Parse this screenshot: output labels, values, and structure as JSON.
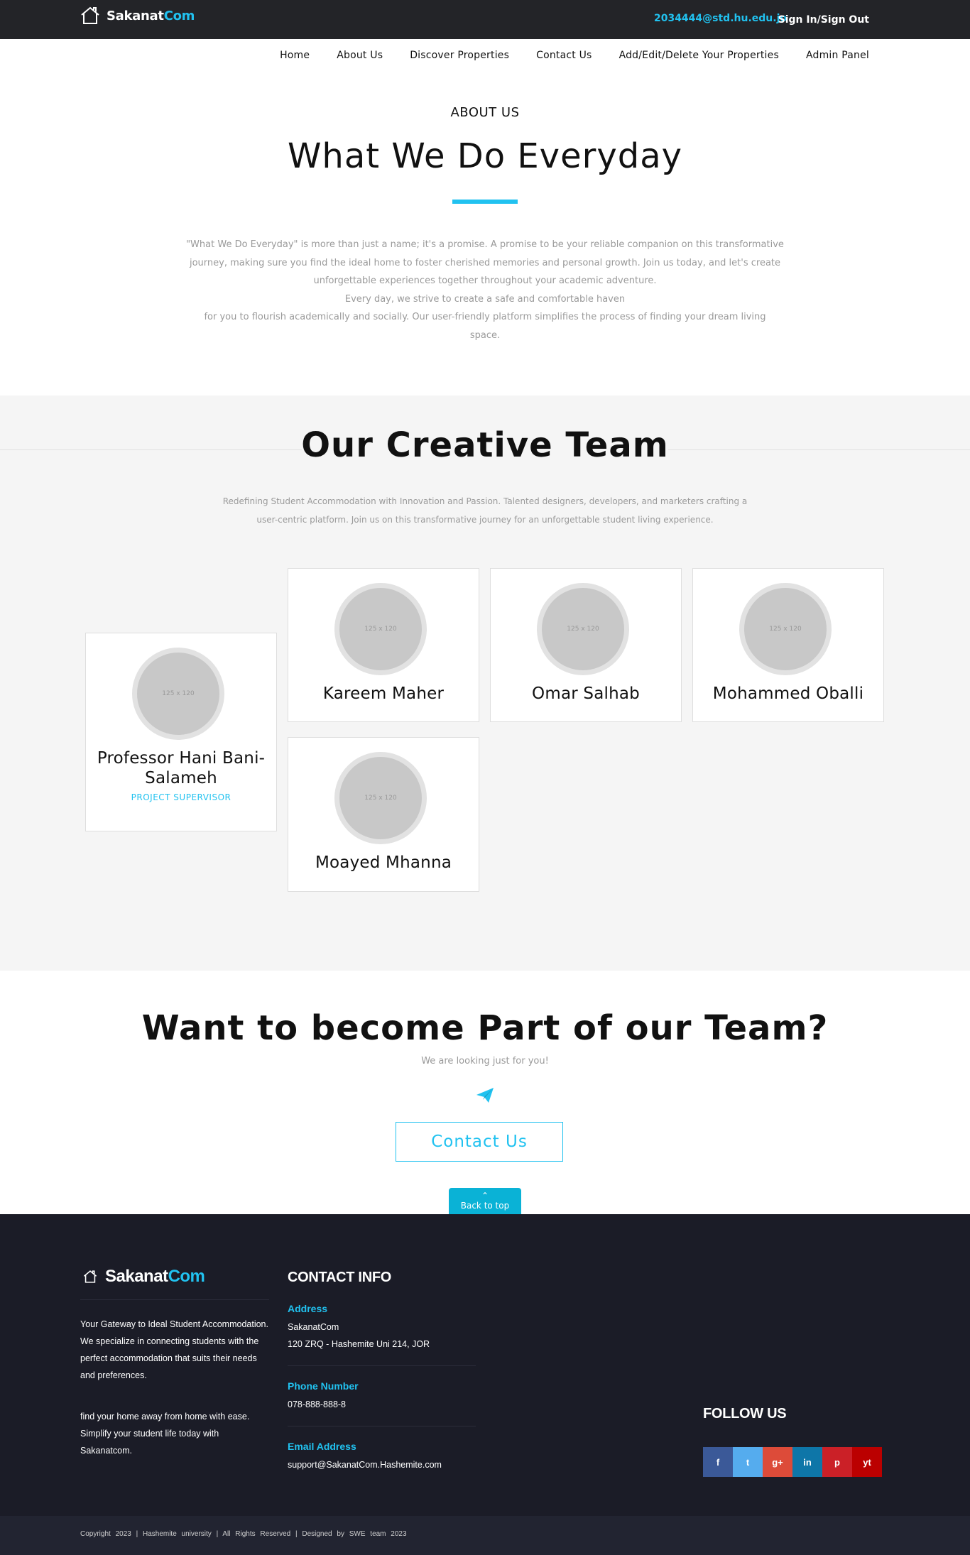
{
  "header": {
    "brand_primary": "Sakanat",
    "brand_accent": "Com",
    "email": "2034444@std.hu.edu.jo",
    "sign_in": "Sign In/Sign Out"
  },
  "nav": [
    "Home",
    "About Us",
    "Discover Properties",
    "Contact Us",
    "Add/Edit/Delete Your Properties",
    "Admin Panel"
  ],
  "about": {
    "kicker": "ABOUT US",
    "title": "What We Do Everyday",
    "line1": "\"What We Do Everyday\" is more than just a name; it's a promise. A promise to be your reliable companion on this transformative",
    "line2": "journey, making sure you find the ideal home to foster cherished memories and personal growth. Join us today, and let's create",
    "line3": "unforgettable experiences together throughout your academic adventure.",
    "line4": "Every day, we strive to create a safe and comfortable haven",
    "line5": "for you to flourish academically and socially. Our user-friendly platform simplifies the process of finding your dream living",
    "line6": "space."
  },
  "team": {
    "title": "Our Creative Team",
    "sub1": "Redefining Student Accommodation with Innovation and Passion. Talented designers, developers, and marketers crafting a",
    "sub2": "user-centric platform. Join us on this transformative journey for an unforgettable student living experience.",
    "placeholder": "125 x 120",
    "members": [
      {
        "name": "Professor Hani Bani-Salameh",
        "role": "PROJECT SUPERVISOR"
      },
      {
        "name": "Kareem Maher"
      },
      {
        "name": "Omar Salhab"
      },
      {
        "name": "Mohammed Oballi"
      },
      {
        "name": "Moayed Mhanna"
      }
    ]
  },
  "join": {
    "title": "Want to become Part of our Team?",
    "subtitle": "We are looking just for you!",
    "button": "Contact Us",
    "back_to_top": "Back to top"
  },
  "footer": {
    "brand_primary": "Sakanat",
    "brand_accent": "Com",
    "about1": "Your Gateway to Ideal Student Accommodation. We specialize in connecting students with the perfect accommodation that suits their needs and preferences.",
    "about2": "find your home away from home with ease. Simplify your student life today with Sakanatcom.",
    "contact_title": "CONTACT INFO",
    "address_label": "Address",
    "address_line1": "SakanatCom",
    "address_line2": "120 ZRQ - Hashemite Uni 214, JOR",
    "phone_label": "Phone Number",
    "phone": "078-888-888-8",
    "email_label": "Email Address",
    "email": "support@SakanatCom.Hashemite.com",
    "follow_title": "FOLLOW US",
    "socials": [
      {
        "label": "f",
        "color": "#3b5998",
        "icon": "facebook-icon"
      },
      {
        "label": "t",
        "color": "#55acee",
        "icon": "twitter-icon"
      },
      {
        "label": "g+",
        "color": "#dd4b39",
        "icon": "google-plus-icon"
      },
      {
        "label": "in",
        "color": "#0e76a8",
        "icon": "linkedin-icon"
      },
      {
        "label": "p",
        "color": "#cb2027",
        "icon": "pinterest-icon"
      },
      {
        "label": "yt",
        "color": "#bb0000",
        "icon": "youtube-icon"
      }
    ],
    "copyright": "Copyright 2023 | Hashemite university | All Rights Reserved | Designed by SWE team 2023"
  },
  "colors": {
    "accent": "#21c2f0",
    "topbar": "#232428",
    "footer": "#1b1c27"
  }
}
